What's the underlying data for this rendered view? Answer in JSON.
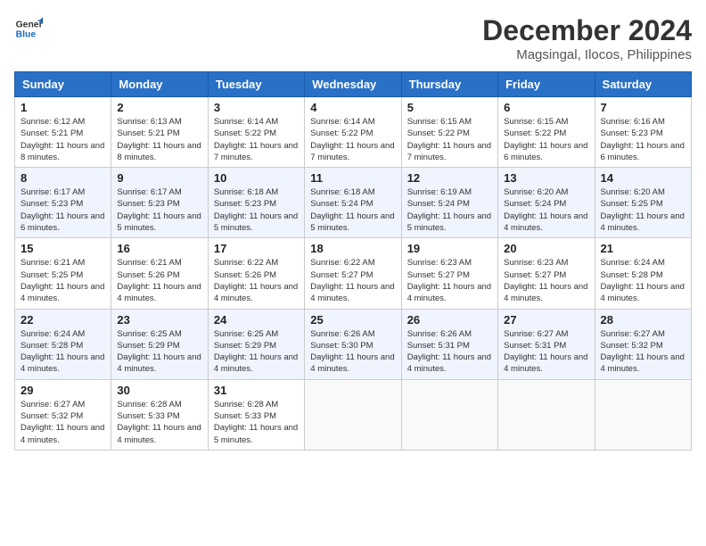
{
  "logo": {
    "line1": "General",
    "line2": "Blue"
  },
  "title": {
    "month_year": "December 2024",
    "location": "Magsingal, Ilocos, Philippines"
  },
  "weekdays": [
    "Sunday",
    "Monday",
    "Tuesday",
    "Wednesday",
    "Thursday",
    "Friday",
    "Saturday"
  ],
  "weeks": [
    [
      {
        "day": "1",
        "sunrise": "Sunrise: 6:12 AM",
        "sunset": "Sunset: 5:21 PM",
        "daylight": "Daylight: 11 hours and 8 minutes."
      },
      {
        "day": "2",
        "sunrise": "Sunrise: 6:13 AM",
        "sunset": "Sunset: 5:21 PM",
        "daylight": "Daylight: 11 hours and 8 minutes."
      },
      {
        "day": "3",
        "sunrise": "Sunrise: 6:14 AM",
        "sunset": "Sunset: 5:22 PM",
        "daylight": "Daylight: 11 hours and 7 minutes."
      },
      {
        "day": "4",
        "sunrise": "Sunrise: 6:14 AM",
        "sunset": "Sunset: 5:22 PM",
        "daylight": "Daylight: 11 hours and 7 minutes."
      },
      {
        "day": "5",
        "sunrise": "Sunrise: 6:15 AM",
        "sunset": "Sunset: 5:22 PM",
        "daylight": "Daylight: 11 hours and 7 minutes."
      },
      {
        "day": "6",
        "sunrise": "Sunrise: 6:15 AM",
        "sunset": "Sunset: 5:22 PM",
        "daylight": "Daylight: 11 hours and 6 minutes."
      },
      {
        "day": "7",
        "sunrise": "Sunrise: 6:16 AM",
        "sunset": "Sunset: 5:23 PM",
        "daylight": "Daylight: 11 hours and 6 minutes."
      }
    ],
    [
      {
        "day": "8",
        "sunrise": "Sunrise: 6:17 AM",
        "sunset": "Sunset: 5:23 PM",
        "daylight": "Daylight: 11 hours and 6 minutes."
      },
      {
        "day": "9",
        "sunrise": "Sunrise: 6:17 AM",
        "sunset": "Sunset: 5:23 PM",
        "daylight": "Daylight: 11 hours and 5 minutes."
      },
      {
        "day": "10",
        "sunrise": "Sunrise: 6:18 AM",
        "sunset": "Sunset: 5:23 PM",
        "daylight": "Daylight: 11 hours and 5 minutes."
      },
      {
        "day": "11",
        "sunrise": "Sunrise: 6:18 AM",
        "sunset": "Sunset: 5:24 PM",
        "daylight": "Daylight: 11 hours and 5 minutes."
      },
      {
        "day": "12",
        "sunrise": "Sunrise: 6:19 AM",
        "sunset": "Sunset: 5:24 PM",
        "daylight": "Daylight: 11 hours and 5 minutes."
      },
      {
        "day": "13",
        "sunrise": "Sunrise: 6:20 AM",
        "sunset": "Sunset: 5:24 PM",
        "daylight": "Daylight: 11 hours and 4 minutes."
      },
      {
        "day": "14",
        "sunrise": "Sunrise: 6:20 AM",
        "sunset": "Sunset: 5:25 PM",
        "daylight": "Daylight: 11 hours and 4 minutes."
      }
    ],
    [
      {
        "day": "15",
        "sunrise": "Sunrise: 6:21 AM",
        "sunset": "Sunset: 5:25 PM",
        "daylight": "Daylight: 11 hours and 4 minutes."
      },
      {
        "day": "16",
        "sunrise": "Sunrise: 6:21 AM",
        "sunset": "Sunset: 5:26 PM",
        "daylight": "Daylight: 11 hours and 4 minutes."
      },
      {
        "day": "17",
        "sunrise": "Sunrise: 6:22 AM",
        "sunset": "Sunset: 5:26 PM",
        "daylight": "Daylight: 11 hours and 4 minutes."
      },
      {
        "day": "18",
        "sunrise": "Sunrise: 6:22 AM",
        "sunset": "Sunset: 5:27 PM",
        "daylight": "Daylight: 11 hours and 4 minutes."
      },
      {
        "day": "19",
        "sunrise": "Sunrise: 6:23 AM",
        "sunset": "Sunset: 5:27 PM",
        "daylight": "Daylight: 11 hours and 4 minutes."
      },
      {
        "day": "20",
        "sunrise": "Sunrise: 6:23 AM",
        "sunset": "Sunset: 5:27 PM",
        "daylight": "Daylight: 11 hours and 4 minutes."
      },
      {
        "day": "21",
        "sunrise": "Sunrise: 6:24 AM",
        "sunset": "Sunset: 5:28 PM",
        "daylight": "Daylight: 11 hours and 4 minutes."
      }
    ],
    [
      {
        "day": "22",
        "sunrise": "Sunrise: 6:24 AM",
        "sunset": "Sunset: 5:28 PM",
        "daylight": "Daylight: 11 hours and 4 minutes."
      },
      {
        "day": "23",
        "sunrise": "Sunrise: 6:25 AM",
        "sunset": "Sunset: 5:29 PM",
        "daylight": "Daylight: 11 hours and 4 minutes."
      },
      {
        "day": "24",
        "sunrise": "Sunrise: 6:25 AM",
        "sunset": "Sunset: 5:29 PM",
        "daylight": "Daylight: 11 hours and 4 minutes."
      },
      {
        "day": "25",
        "sunrise": "Sunrise: 6:26 AM",
        "sunset": "Sunset: 5:30 PM",
        "daylight": "Daylight: 11 hours and 4 minutes."
      },
      {
        "day": "26",
        "sunrise": "Sunrise: 6:26 AM",
        "sunset": "Sunset: 5:31 PM",
        "daylight": "Daylight: 11 hours and 4 minutes."
      },
      {
        "day": "27",
        "sunrise": "Sunrise: 6:27 AM",
        "sunset": "Sunset: 5:31 PM",
        "daylight": "Daylight: 11 hours and 4 minutes."
      },
      {
        "day": "28",
        "sunrise": "Sunrise: 6:27 AM",
        "sunset": "Sunset: 5:32 PM",
        "daylight": "Daylight: 11 hours and 4 minutes."
      }
    ],
    [
      {
        "day": "29",
        "sunrise": "Sunrise: 6:27 AM",
        "sunset": "Sunset: 5:32 PM",
        "daylight": "Daylight: 11 hours and 4 minutes."
      },
      {
        "day": "30",
        "sunrise": "Sunrise: 6:28 AM",
        "sunset": "Sunset: 5:33 PM",
        "daylight": "Daylight: 11 hours and 4 minutes."
      },
      {
        "day": "31",
        "sunrise": "Sunrise: 6:28 AM",
        "sunset": "Sunset: 5:33 PM",
        "daylight": "Daylight: 11 hours and 5 minutes."
      },
      null,
      null,
      null,
      null
    ]
  ]
}
